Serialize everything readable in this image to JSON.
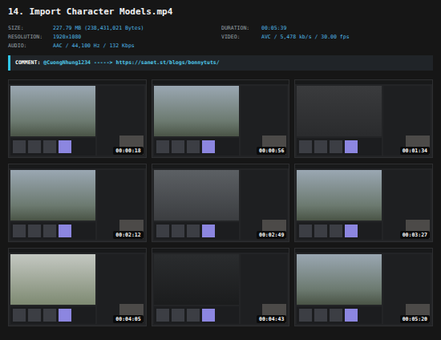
{
  "title": "14. Import Character Models.mp4",
  "info": [
    {
      "label": "SIZE:",
      "value": "227.79 MB (238,431,021 Bytes)"
    },
    {
      "label": "DURATION:",
      "value": "00:05:39"
    },
    {
      "label": "RESOLUTION:",
      "value": "1920x1080"
    },
    {
      "label": "VIDEO:",
      "value": "AVC / 5,478 kb/s / 30.00 fps"
    },
    {
      "label": "AUDIO:",
      "value": "AAC / 44,100 Hz / 132 Kbps"
    }
  ],
  "comment": {
    "label": "COMMENT:",
    "user": "@CuongNhung1234",
    "arrow": "----->",
    "link": "https://sanet.st/blogs/bonnytuts/"
  },
  "frames": [
    {
      "time": "00:00:18"
    },
    {
      "time": "00:00:56"
    },
    {
      "time": "00:01:34"
    },
    {
      "time": "00:02:12"
    },
    {
      "time": "00:02:49"
    },
    {
      "time": "00:03:27"
    },
    {
      "time": "00:04:05"
    },
    {
      "time": "00:04:43"
    },
    {
      "time": "00:05:20"
    }
  ]
}
